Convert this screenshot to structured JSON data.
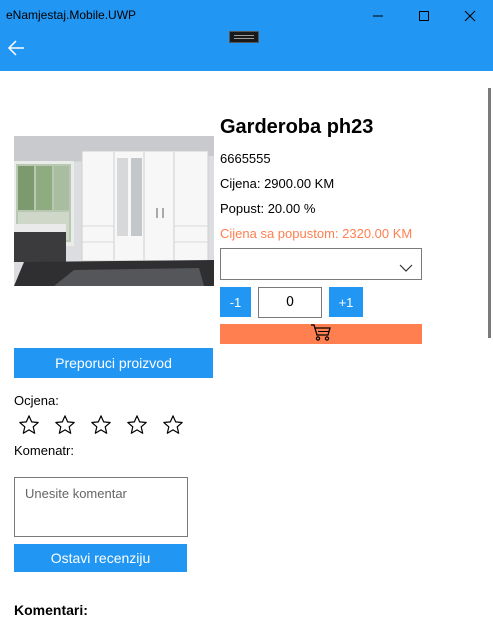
{
  "window": {
    "title": "eNamjestaj.Mobile.UWP"
  },
  "product": {
    "name": "Garderoba ph23",
    "code": "6665555",
    "price": "Cijena: 2900.00 KM",
    "discount": "Popust: 20.00 %",
    "discounted_price": "Cijena sa popustom: 2320.00 KM"
  },
  "quantity": {
    "decrement_label": "-1",
    "value": "0",
    "increment_label": "+1"
  },
  "actions": {
    "recommend_label": "Preporuci proizvod",
    "submit_review_label": "Ostavi recenziju"
  },
  "review": {
    "rating_label": "Ocjena:",
    "rating_value": 0,
    "rating_max": 5,
    "comment_label": "Komenatr:",
    "comment_placeholder": "Unesite komentar",
    "comment_value": ""
  },
  "comments": {
    "title": "Komentari:"
  },
  "colors": {
    "accent": "#2196f3",
    "cart": "#ff7f50",
    "discount_text": "#ff7f50"
  },
  "icons": {
    "back": "arrow-left-icon",
    "minimize": "minimize-icon",
    "maximize": "maximize-icon",
    "close": "close-icon",
    "dropdown": "chevron-down-icon",
    "cart": "shopping-cart-icon",
    "rating": "star-outline-icon"
  }
}
